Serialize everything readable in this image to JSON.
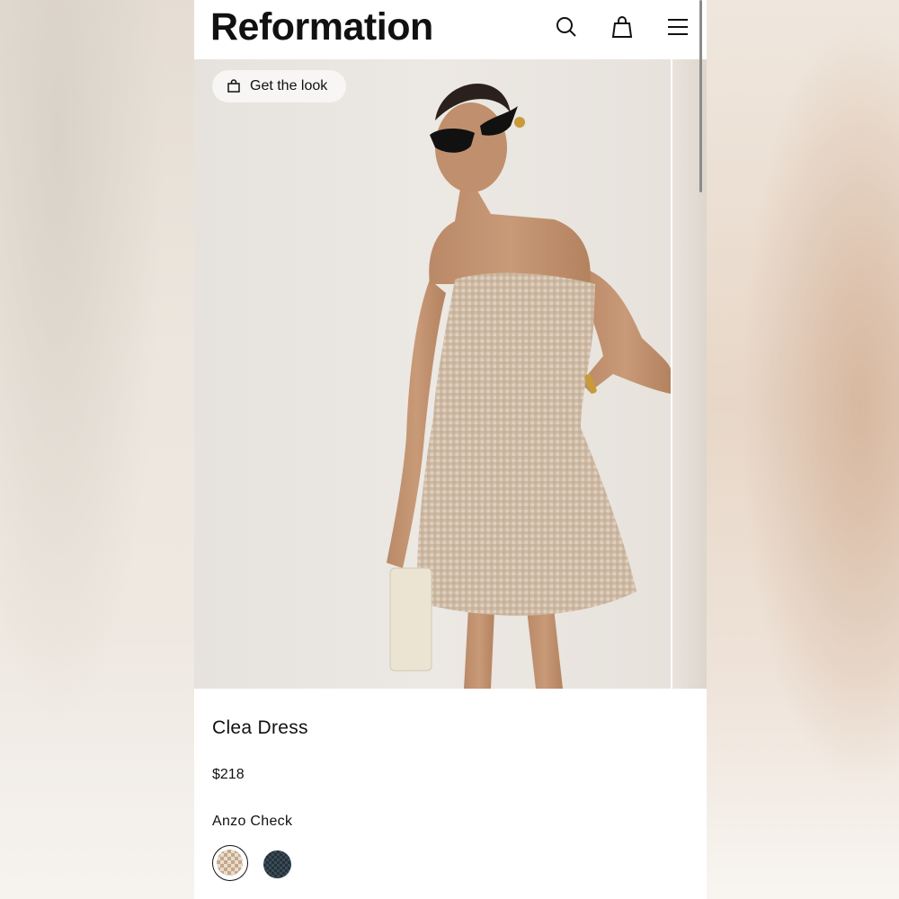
{
  "header": {
    "logo": "Reformation",
    "icons": [
      "search-icon",
      "bag-icon",
      "menu-icon"
    ]
  },
  "hero": {
    "get_the_look_label": "Get the look",
    "get_the_look_icon": "bag-icon"
  },
  "product": {
    "title": "Clea Dress",
    "price": "$218",
    "color_name": "Anzo Check",
    "swatches": [
      {
        "name": "Anzo Check",
        "selected": true,
        "colors": [
          "#e9dccb",
          "#c3a88c"
        ]
      },
      {
        "name": "dark check",
        "selected": false,
        "colors": [
          "#3b4b56",
          "#24323c"
        ]
      }
    ]
  }
}
